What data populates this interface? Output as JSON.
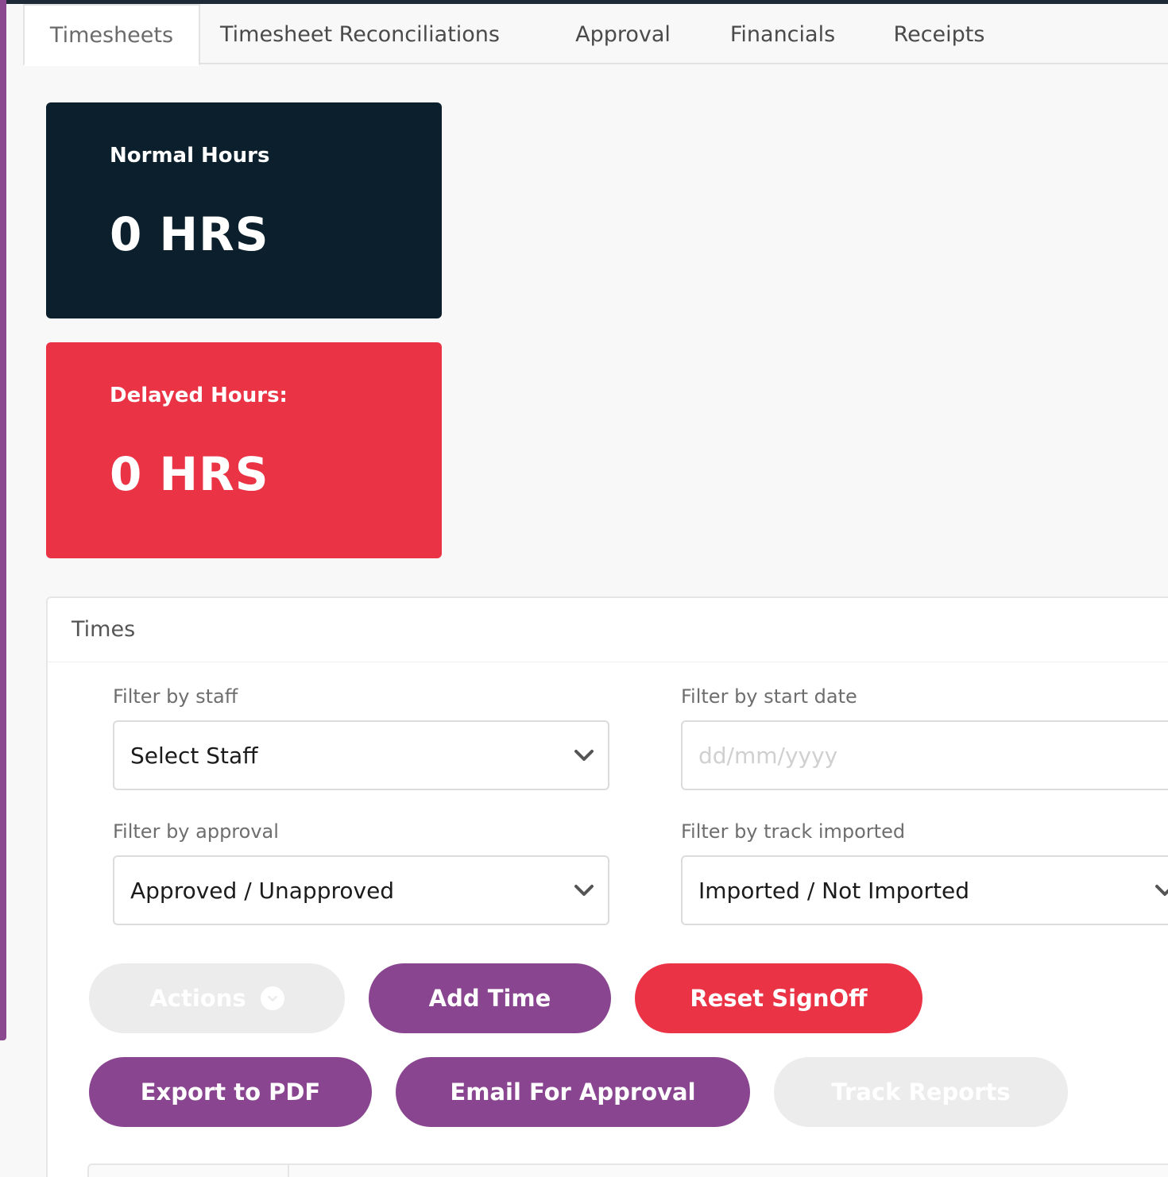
{
  "tabs": [
    {
      "label": "Timesheets",
      "active": true
    },
    {
      "label": "Timesheet Reconciliations",
      "active": false
    },
    {
      "label": "Approval",
      "active": false
    },
    {
      "label": "Financials",
      "active": false
    },
    {
      "label": "Receipts",
      "active": false
    }
  ],
  "cards": {
    "normal": {
      "label": "Normal Hours",
      "value": "0 HRS",
      "color": "#0c1f2c"
    },
    "delayed": {
      "label": "Delayed Hours:",
      "value": "0 HRS",
      "color": "#ea3345"
    }
  },
  "times_panel": {
    "title": "Times",
    "filters": {
      "staff": {
        "label": "Filter by staff",
        "value": "Select Staff",
        "icon": "chevron-down-icon"
      },
      "start_date": {
        "label": "Filter by start date",
        "placeholder": "dd/mm/yyyy"
      },
      "approval": {
        "label": "Filter by approval",
        "value": "Approved / Unapproved",
        "icon": "chevron-down-icon"
      },
      "track_imported": {
        "label": "Filter by track imported",
        "value": "Imported / Not Imported",
        "icon": "chevron-down-icon"
      }
    },
    "buttons": {
      "actions": {
        "label": "Actions",
        "icon": "chevron-down-circle-icon",
        "enabled": false
      },
      "add_time": {
        "label": "Add Time",
        "enabled": true
      },
      "reset_signoff": {
        "label": "Reset SignOff",
        "enabled": true
      },
      "export_pdf": {
        "label": "Export to PDF",
        "enabled": true
      },
      "email_approval": {
        "label": "Email For Approval",
        "enabled": true
      },
      "track_reports": {
        "label": "Track Reports",
        "enabled": false
      }
    }
  },
  "colors": {
    "brand_purple": "#894590",
    "danger_red": "#ea3345",
    "dark_navy": "#0c1f2c"
  }
}
